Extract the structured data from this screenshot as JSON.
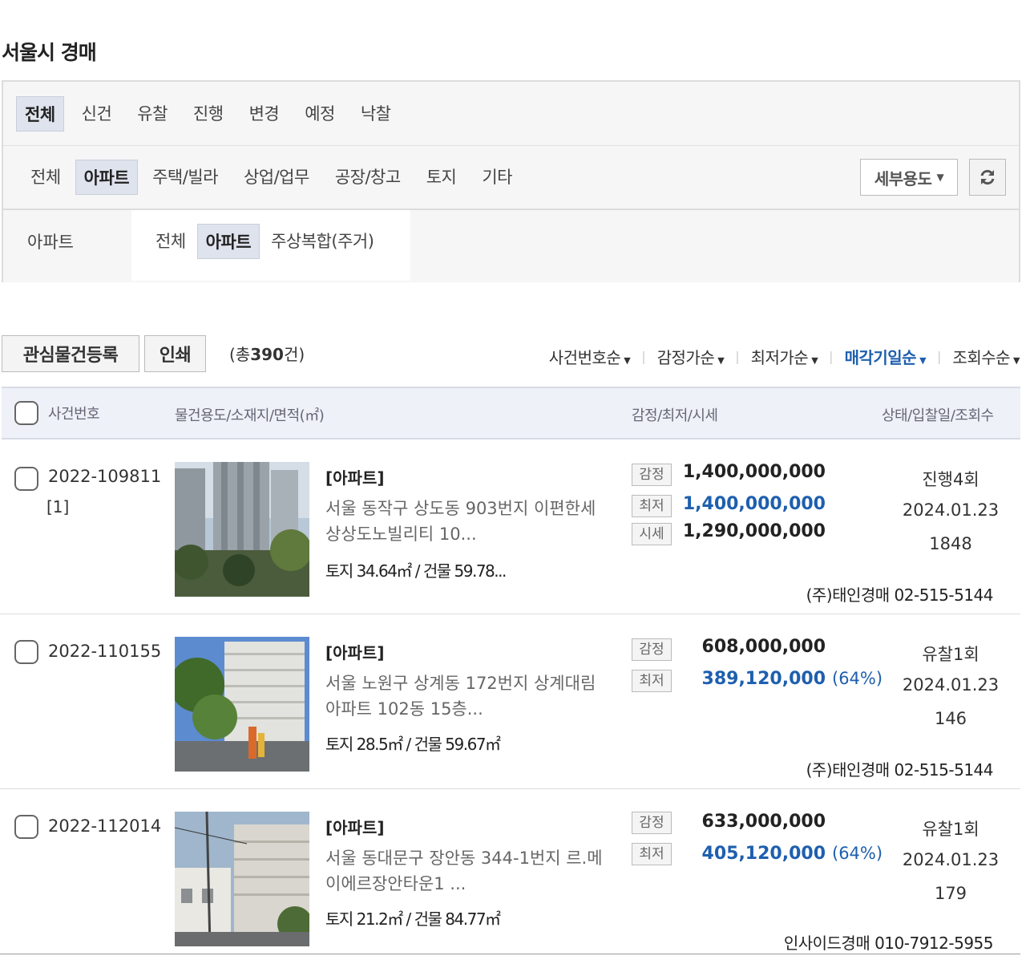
{
  "page_title": "서울시 경매",
  "filters": {
    "status_tabs": [
      {
        "label": "전체",
        "selected": true
      },
      {
        "label": "신건",
        "selected": false
      },
      {
        "label": "유찰",
        "selected": false
      },
      {
        "label": "진행",
        "selected": false
      },
      {
        "label": "변경",
        "selected": false
      },
      {
        "label": "예정",
        "selected": false
      },
      {
        "label": "낙찰",
        "selected": false
      }
    ],
    "category_tabs": [
      {
        "label": "전체",
        "selected": false
      },
      {
        "label": "아파트",
        "selected": true
      },
      {
        "label": "주택/빌라",
        "selected": false
      },
      {
        "label": "상업/업무",
        "selected": false
      },
      {
        "label": "공장/창고",
        "selected": false
      },
      {
        "label": "토지",
        "selected": false
      },
      {
        "label": "기타",
        "selected": false
      }
    ],
    "usage_select": "세부용도",
    "sub_label": "아파트",
    "sub_tabs": [
      {
        "label": "전체",
        "selected": false
      },
      {
        "label": "아파트",
        "selected": true
      },
      {
        "label": "주상복합(주거)",
        "selected": false
      }
    ]
  },
  "toolbar": {
    "watch_button": "관심물건등록",
    "print_button": "인쇄",
    "total_prefix": "(총",
    "total_count": "390",
    "total_suffix": "건)",
    "sorts": [
      {
        "label": "사건번호순",
        "active": false
      },
      {
        "label": "감정가순",
        "active": false
      },
      {
        "label": "최저가순",
        "active": false
      },
      {
        "label": "매각기일순",
        "active": true
      },
      {
        "label": "조회수순",
        "active": false
      }
    ]
  },
  "table_header": {
    "case": "사건번호",
    "property": "물건용도/소재지/면적(㎡)",
    "price": "감정/최저/시세",
    "status": "상태/입찰일/조회수"
  },
  "listings": [
    {
      "case_no": "2022-109811",
      "case_sub": "[1]",
      "type": "[아파트]",
      "address": "서울 동작구 상도동 903번지 이편한세상상도노빌리티 10...",
      "area": "토지 34.64㎡ / 건물 59.78...",
      "appraisal_label": "감정",
      "appraisal": "1,400,000,000",
      "minimum_label": "최저",
      "minimum": "1,400,000,000",
      "minimum_pct": "",
      "market_label": "시세",
      "market": "1,290,000,000",
      "status": "진행4회",
      "date": "2024.01.23",
      "views": "1848",
      "agency": "(주)태인경매 02-515-5144"
    },
    {
      "case_no": "2022-110155",
      "case_sub": "",
      "type": "[아파트]",
      "address": "서울 노원구 상계동 172번지 상계대림아파트 102동 15층...",
      "area": "토지 28.5㎡ / 건물 59.67㎡",
      "appraisal_label": "감정",
      "appraisal": "608,000,000",
      "minimum_label": "최저",
      "minimum": "389,120,000",
      "minimum_pct": "(64%)",
      "market_label": "",
      "market": "",
      "status": "유찰1회",
      "date": "2024.01.23",
      "views": "146",
      "agency": "(주)태인경매 02-515-5144"
    },
    {
      "case_no": "2022-112014",
      "case_sub": "",
      "type": "[아파트]",
      "address": "서울 동대문구 장안동 344-1번지 르.메이에르장안타운1 ...",
      "area": "토지 21.2㎡ / 건물 84.77㎡",
      "appraisal_label": "감정",
      "appraisal": "633,000,000",
      "minimum_label": "최저",
      "minimum": "405,120,000",
      "minimum_pct": "(64%)",
      "market_label": "",
      "market": "",
      "status": "유찰1회",
      "date": "2024.01.23",
      "views": "179",
      "agency": "인사이드경매 010-7912-5955"
    }
  ]
}
